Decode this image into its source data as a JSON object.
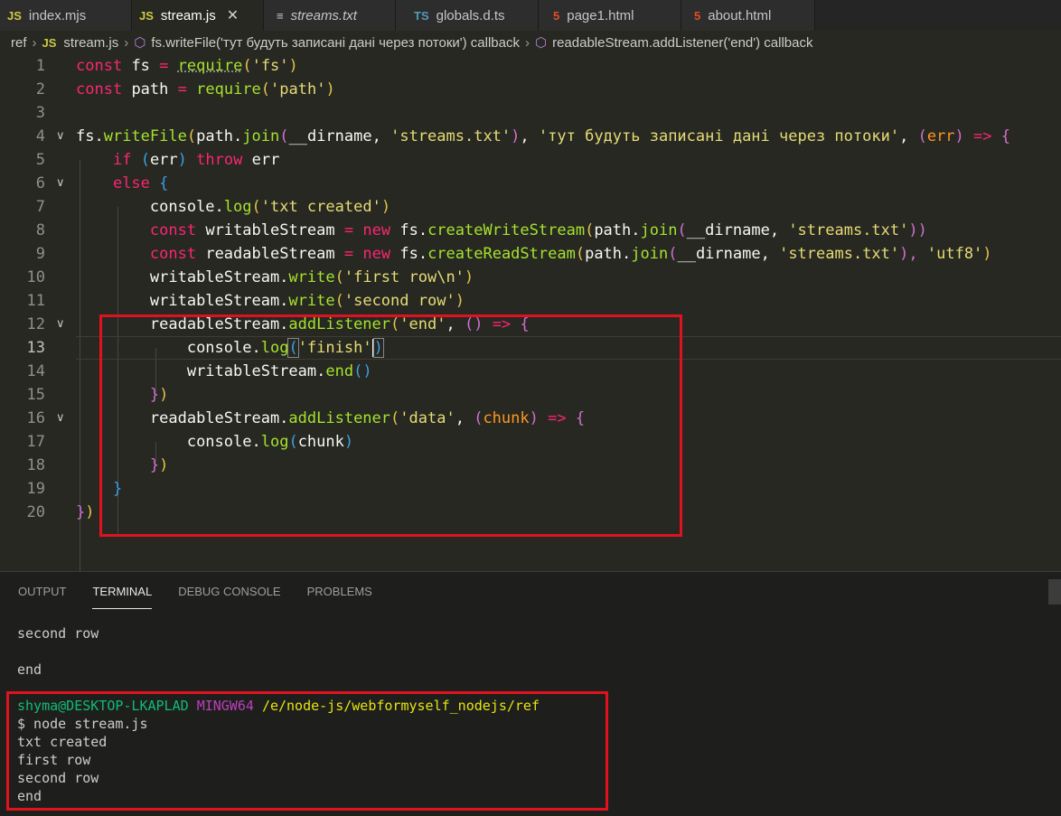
{
  "tabs": [
    {
      "icon": "JS",
      "label": "index.mjs"
    },
    {
      "icon": "JS",
      "label": "stream.js",
      "close": "✕"
    },
    {
      "icon": "≡",
      "label": "streams.txt"
    },
    {
      "icon": "TS",
      "label": "globals.d.ts"
    },
    {
      "icon": "5",
      "label": "page1.html"
    },
    {
      "icon": "5",
      "label": "about.html"
    }
  ],
  "breadcrumb": {
    "folder": "ref",
    "file_icon": "JS",
    "file": "stream.js",
    "symbol1": "fs.writeFile('тут будуть записані дані через потоки') callback",
    "symbol2": "readableStream.addListener('end') callback"
  },
  "editor": {
    "line_numbers": [
      "1",
      "2",
      "3",
      "4",
      "5",
      "6",
      "7",
      "8",
      "9",
      "10",
      "11",
      "12",
      "13",
      "14",
      "15",
      "16",
      "17",
      "18",
      "19",
      "20"
    ],
    "lines": {
      "l1": [
        "const",
        "fs",
        "=",
        "require",
        "(",
        "'fs'",
        ")"
      ],
      "l2": [
        "const",
        "path",
        "=",
        "require",
        "(",
        "'path'",
        ")"
      ],
      "l4": [
        "fs.",
        "writeFile",
        "(",
        "path.",
        "join",
        "(",
        "__dirname,",
        "'streams.txt'",
        ")",
        ",",
        "'тут будуть записані дані через потоки'",
        ",",
        "(",
        "err",
        ")",
        "=>",
        "{"
      ],
      "l5": [
        "if",
        "(",
        "err",
        ")",
        "throw",
        "err"
      ],
      "l6": [
        "else",
        "{"
      ],
      "l7": [
        "console.",
        "log",
        "(",
        "'txt created'",
        ")"
      ],
      "l8": [
        "const",
        "writableStream",
        "=",
        "new",
        "fs.",
        "createWriteStream",
        "(",
        "path.",
        "join",
        "(",
        "__dirname,",
        "'streams.txt'",
        "))"
      ],
      "l9": [
        "const",
        "readableStream",
        "=",
        "new",
        "fs.",
        "createReadStream",
        "(",
        "path.",
        "join",
        "(",
        "__dirname,",
        "'streams.txt'",
        "),",
        "'utf8'",
        ")"
      ],
      "l10": [
        "writableStream.",
        "write",
        "(",
        "'first row\\n'",
        ")"
      ],
      "l11": [
        "writableStream.",
        "write",
        "(",
        "'second row'",
        ")"
      ],
      "l12": [
        "readableStream.",
        "addListener",
        "(",
        "'end'",
        ",",
        "()",
        "=>",
        "{"
      ],
      "l13": [
        "console.",
        "log",
        "(",
        "'finish'",
        ")"
      ],
      "l14": [
        "writableStream.",
        "end",
        "()"
      ],
      "l15": [
        "}",
        ")"
      ],
      "l16": [
        "readableStream.",
        "addListener",
        "(",
        "'data'",
        ",",
        "(",
        "chunk",
        ")",
        "=>",
        "{"
      ],
      "l17": [
        "console.",
        "log",
        "(",
        "chunk",
        ")"
      ],
      "l18": [
        "}",
        ")"
      ],
      "l19": [
        "}"
      ],
      "l20": [
        "}",
        ")"
      ]
    }
  },
  "panel": {
    "tabs": [
      "OUTPUT",
      "TERMINAL",
      "DEBUG CONSOLE",
      "PROBLEMS"
    ],
    "terminal": {
      "prev1": "second row",
      "prev2": "end",
      "user": "shyma@DESKTOP-LKAPLAD",
      "shell": "MINGW64",
      "path": "/e/node-js/webformyself_nodejs/ref",
      "cmd": "$ node stream.js",
      "out": [
        "txt created",
        "first row",
        "second row",
        "end"
      ]
    }
  },
  "colors": {
    "highlight_box": "#e0121f",
    "keyword": "#f92672",
    "function": "#a6e22e",
    "string": "#e6db74"
  }
}
